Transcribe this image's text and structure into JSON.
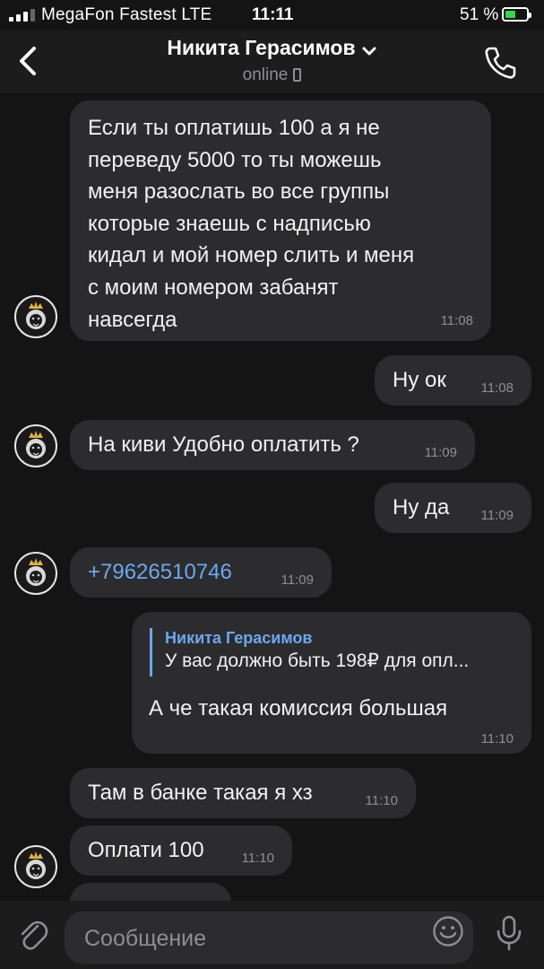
{
  "status_bar": {
    "carrier": "MegaFon Fastest  LTE",
    "time": "11:11",
    "battery_percent": "51 %",
    "battery_level": 0.51
  },
  "header": {
    "contact_name": "Никита Герасимов",
    "presence": "online",
    "icons": [
      "back-chevron-icon",
      "dropdown-chevron-icon",
      "phone-call-icon",
      "mobile-device-icon"
    ]
  },
  "messages": [
    {
      "side": "incoming",
      "lines": [
        "Если ты оплатишь 100 а я не",
        "переведу 5000 то ты можешь",
        "меня разослать во все группы",
        "которые знаешь с надписью",
        "кидал и мой номер слить и меня",
        "с моим номером забанят",
        "навсегда"
      ],
      "time": "11:08"
    },
    {
      "side": "outgoing",
      "text": "Ну ок",
      "time": "11:08"
    },
    {
      "side": "incoming",
      "text": "На киви Удобно оплатить ?",
      "time": "11:09"
    },
    {
      "side": "outgoing",
      "text": "Ну да",
      "time": "11:09"
    },
    {
      "side": "incoming",
      "text": "+79626510746",
      "is_link": true,
      "time": "11:09"
    },
    {
      "side": "outgoing",
      "reply_to_name": "Никита Герасимов",
      "reply_to_text": "У вас должно быть 198₽ для опл...",
      "text": "А че такая комиссия большая",
      "time": "11:10"
    },
    {
      "side": "incoming",
      "text": "Там в банке такая я хз",
      "time": "11:10"
    },
    {
      "side": "incoming",
      "text": "Оплати 100",
      "time": "11:10"
    }
  ],
  "input_bar": {
    "placeholder": "Сообщение",
    "icons": [
      "attachment-icon",
      "emoji-icon",
      "microphone-icon"
    ]
  },
  "colors": {
    "background": "#141414",
    "bubble": "#2c2c2e",
    "link": "#6ba8f0",
    "battery_fill": "#32d74b"
  }
}
